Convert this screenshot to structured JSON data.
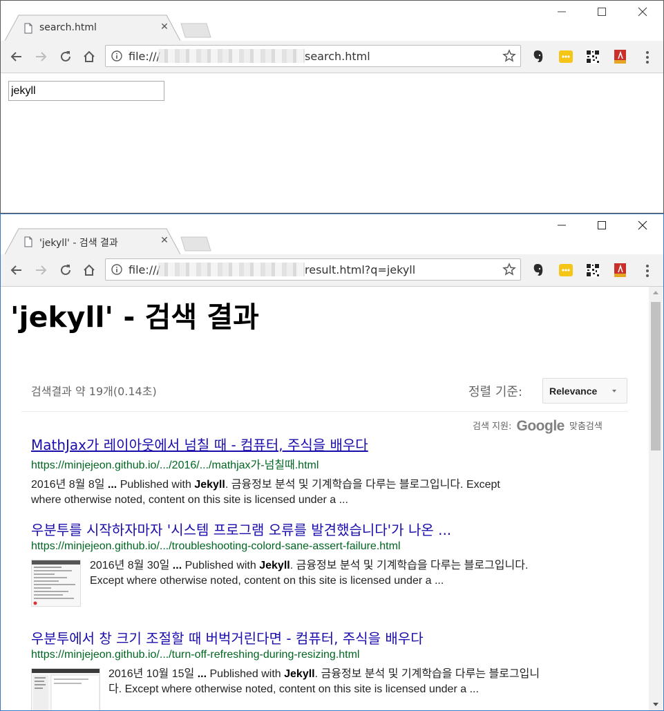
{
  "window1": {
    "tab_title": "search.html",
    "url_scheme": "file:///",
    "url_path": "search.html",
    "search_value": "jekyll"
  },
  "window2": {
    "tab_title": "'jekyll' - 검색 결과",
    "url_scheme": "file:///",
    "url_path": "result.html?q=jekyll",
    "heading": "'jekyll' - 검색 결과",
    "stats": "검색결과 약 19개(0.14초)",
    "sort_label": "정렬 기준:",
    "sort_value": "Relevance",
    "powered_prefix": "검색 지원:",
    "powered_logo": "Google",
    "powered_suffix": "맞춤검색",
    "results": [
      {
        "title": "MathJax가 레이아웃에서 넘칠 때 - 컴퓨터, 주식을 배우다",
        "url": "https://minjejeon.github.io/.../2016/.../mathjax가-넘칠때.html",
        "date": "2016년 8월 8일",
        "ellipsis": "...",
        "pre": "Published with",
        "bold": "Jekyll",
        "line1_rest": ". 금융정보 분석 및 기계학습을 다루는 블로그입니다. Except",
        "line2": "where otherwise noted, content on this site is licensed under a ..."
      },
      {
        "title": "우분투를 시작하자마자 '시스템 프로그램 오류를 발견했습니다'가 나온 ...",
        "url": "https://minjejeon.github.io/.../troubleshooting-colord-sane-assert-failure.html",
        "date": "2016년 8월 30일",
        "ellipsis": "...",
        "pre": "Published with",
        "bold": "Jekyll",
        "line1_rest": ". 금융정보 분석 및 기계학습을 다루는 블로그입니다.",
        "line2": "Except where otherwise noted, content on this site is licensed under a ..."
      },
      {
        "title": "우분투에서 창 크기 조절할 때 버벅거린다면 - 컴퓨터, 주식을 배우다",
        "url": "https://minjejeon.github.io/.../turn-off-refreshing-during-resizing.html",
        "date": "2016년 10월 15일",
        "ellipsis": "...",
        "pre": "Published with",
        "bold": "Jekyll",
        "line1_rest": ". 금융정보 분석 및 기계학습을 다루는 블로그입니",
        "line2": "다. Except where otherwise noted, content on this site is licensed under a ..."
      }
    ]
  },
  "colors": {
    "link": "#1a0dab",
    "url_green": "#006621",
    "toolbar_bg": "#f2f2f2"
  },
  "icons": [
    "page-icon",
    "close-icon",
    "back-icon",
    "forward-icon",
    "reload-icon",
    "home-icon",
    "info-icon",
    "star-icon",
    "evernote-icon",
    "ext-yellow-icon",
    "qr-icon",
    "pdf-icon",
    "menu-icon",
    "minimize-icon",
    "maximize-icon",
    "window-close-icon"
  ]
}
